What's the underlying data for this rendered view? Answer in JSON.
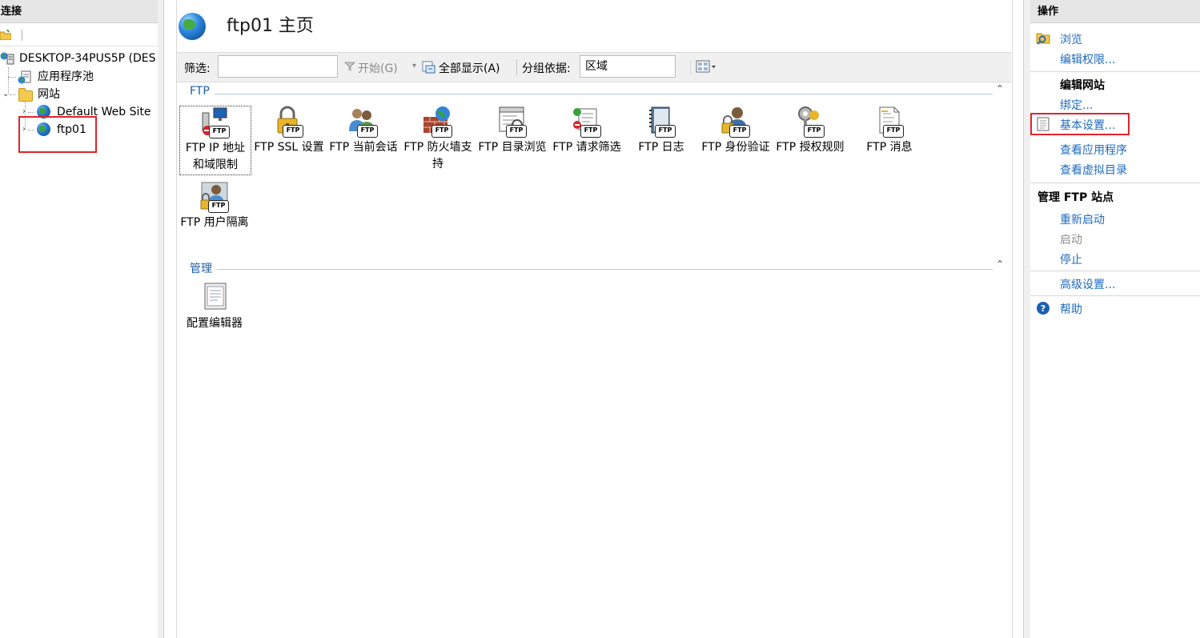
{
  "connections": {
    "header": "连接",
    "tree": [
      {
        "label": "DESKTOP-34PUS5P (DES",
        "icon": "server-icon"
      },
      {
        "label": "应用程序池",
        "icon": "app-pool-icon"
      },
      {
        "label": "网站",
        "icon": "sites-folder-icon"
      },
      {
        "label": "Default Web Site",
        "icon": "globe-icon"
      },
      {
        "label": "ftp01",
        "icon": "globe-icon",
        "selected": true
      }
    ]
  },
  "main": {
    "title": "ftp01 主页",
    "filter": {
      "label": "筛选:",
      "value": "",
      "start_label": "开始(G)",
      "show_all_label": "全部显示(A)",
      "group_by_label": "分组依据:",
      "group_by_value": "区域"
    },
    "sections": [
      {
        "title": "FTP",
        "features": [
          {
            "label": "FTP IP 地址和域限制",
            "icon": "ftp-ip-restriction-icon"
          },
          {
            "label": "FTP SSL 设置",
            "icon": "ftp-ssl-lock-icon"
          },
          {
            "label": "FTP 当前会话",
            "icon": "ftp-sessions-icon"
          },
          {
            "label": "FTP 防火墙支持",
            "icon": "ftp-firewall-icon"
          },
          {
            "label": "FTP 目录浏览",
            "icon": "ftp-directory-browsing-icon"
          },
          {
            "label": "FTP 请求筛选",
            "icon": "ftp-request-filtering-icon"
          },
          {
            "label": "FTP 日志",
            "icon": "ftp-logging-icon"
          },
          {
            "label": "FTP 身份验证",
            "icon": "ftp-authentication-icon"
          },
          {
            "label": "FTP 授权规则",
            "icon": "ftp-authorization-icon"
          },
          {
            "label": "FTP 消息",
            "icon": "ftp-messages-icon"
          },
          {
            "label": "FTP 用户隔离",
            "icon": "ftp-user-isolation-icon"
          }
        ]
      },
      {
        "title": "管理",
        "features": [
          {
            "label": "配置编辑器",
            "icon": "configuration-editor-icon"
          }
        ]
      }
    ]
  },
  "actions": {
    "header": "操作",
    "items": {
      "browse": "浏览",
      "edit_permissions": "编辑权限...",
      "edit_site_title": "编辑网站",
      "bindings": "绑定...",
      "basic_settings": "基本设置...",
      "view_applications": "查看应用程序",
      "view_virtual_dirs": "查看虚拟目录",
      "manage_ftp_title": "管理 FTP 站点",
      "restart": "重新启动",
      "start": "启动",
      "stop": "停止",
      "advanced_settings": "高级设置...",
      "help": "帮助"
    }
  },
  "colors": {
    "link": "#1f6bbd",
    "highlight": "#e0242b",
    "section_title": "#1f5ea8"
  }
}
